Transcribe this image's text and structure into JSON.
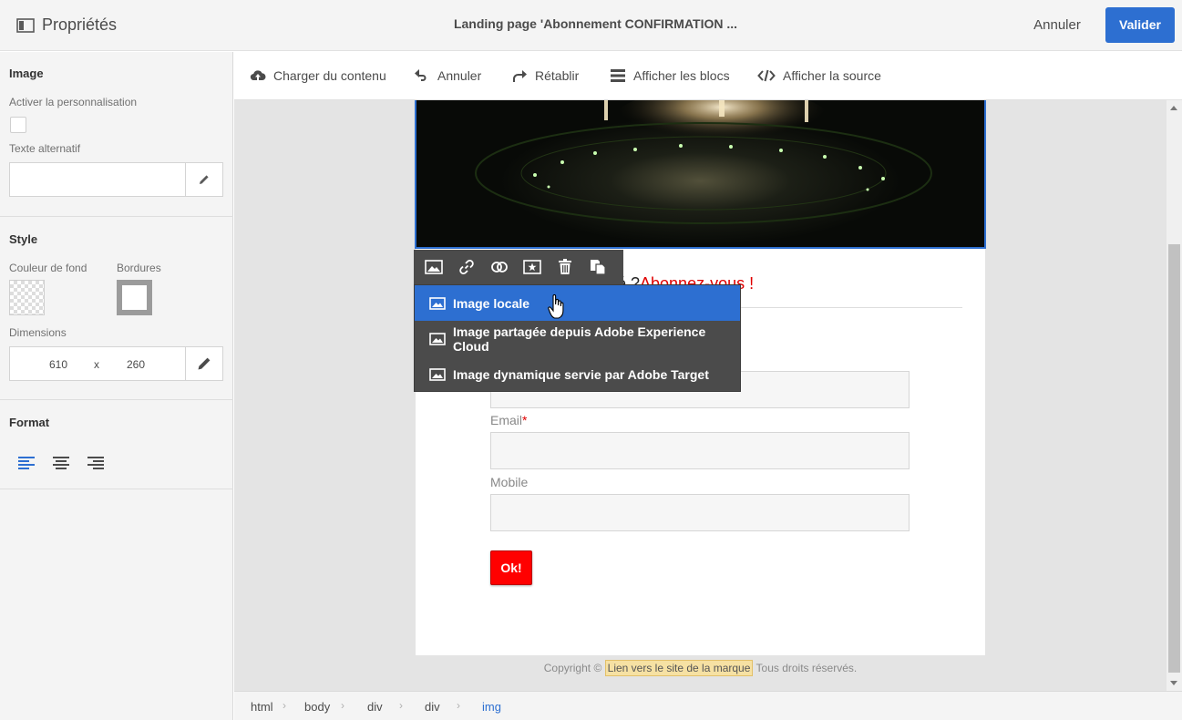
{
  "header": {
    "panel_title": "Propriétés",
    "page_title": "Landing page 'Abonnement CONFIRMATION ...",
    "cancel_label": "Annuler",
    "validate_label": "Valider"
  },
  "left_panel": {
    "image_section": {
      "title": "Image",
      "personalization_label": "Activer la personnalisation",
      "personalization_checked": false,
      "alt_text_label": "Texte alternatif",
      "alt_text_value": ""
    },
    "style_section": {
      "title": "Style",
      "bg_color_label": "Couleur de fond",
      "borders_label": "Bordures",
      "dimensions_label": "Dimensions",
      "width": "610",
      "separator": "x",
      "height": "260"
    },
    "format_section": {
      "title": "Format",
      "selected_alignment": "left"
    }
  },
  "toolbar": {
    "upload_label": "Charger du contenu",
    "undo_label": "Annuler",
    "redo_label": "Rétablir",
    "show_blocks_label": "Afficher les blocs",
    "show_source_label": "Afficher la source"
  },
  "canvas": {
    "heading_visible": "rmé ?",
    "heading_red": "Abonnez-vous !",
    "email_label": "Email",
    "required_mark": "*",
    "mobile_label": "Mobile",
    "ok_label": "Ok!",
    "copyright_prefix": "Copyright ©",
    "copyright_link": "Lien vers le site de la marque",
    "copyright_suffix": "Tous droits réservés."
  },
  "image_menu": {
    "items": [
      {
        "label": "Image locale",
        "active": true
      },
      {
        "label": "Image partagée depuis Adobe Experience Cloud",
        "active": false
      },
      {
        "label": "Image dynamique servie par Adobe Target",
        "active": false
      }
    ]
  },
  "breadcrumb": {
    "items": [
      "html",
      "body",
      "div",
      "div",
      "img"
    ],
    "selected": "img"
  },
  "colors": {
    "accent": "#2d6fd1",
    "ok_button": "#ff0000",
    "heading_red": "#e00000"
  }
}
